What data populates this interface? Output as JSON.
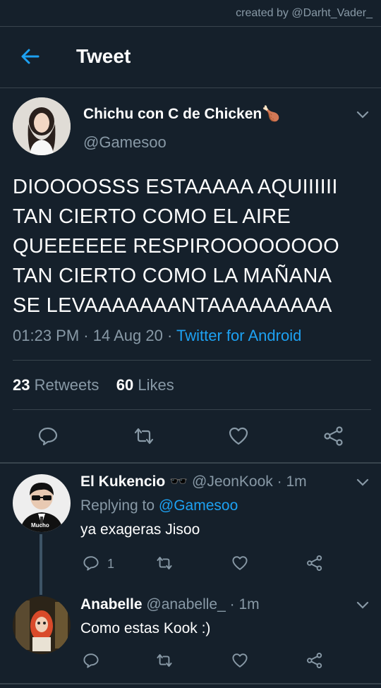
{
  "credit": "created by @Darht_Vader_",
  "header": {
    "title": "Tweet"
  },
  "main_tweet": {
    "display_name": "Chichu con C de Chicken",
    "name_emoji": "🍗",
    "handle": "@Gamesoo",
    "text_lines": [
      "DIOOOOSSS ESTAAAAA AQUIIIIII",
      "TAN CIERTO COMO EL AIRE",
      "QUEEEEEE RESPIROOOOOOOO",
      "TAN CIERTO COMO LA MAÑANA",
      "SE LEVAAAAAAANTAAAAAAAAA"
    ],
    "time": "01:23 PM",
    "date": "14 Aug 20",
    "source": "Twitter for Android",
    "retweets_count": "23",
    "retweets_label": "Retweets",
    "likes_count": "60",
    "likes_label": "Likes"
  },
  "replies": [
    {
      "display_name": "El Kukencio",
      "name_emoji": "🕶️",
      "handle": "@JeonKook",
      "time": "· 1m",
      "replying_prefix": "Replying to",
      "replying_to": "@Gamesoo",
      "text": "ya exageras Jisoo",
      "avatar_caption": "Mucho",
      "reply_count": "1"
    },
    {
      "display_name": "Anabelle",
      "handle": "@anabelle_",
      "time": "· 1m",
      "text": "Como estas Kook :)"
    }
  ],
  "colors": {
    "background": "#15202b",
    "divider": "#38444d",
    "secondary_text": "#8899a6",
    "accent": "#1da1f2"
  },
  "icons": [
    "back-arrow-icon",
    "chevron-down-icon",
    "reply-icon",
    "retweet-icon",
    "like-icon",
    "share-icon"
  ]
}
